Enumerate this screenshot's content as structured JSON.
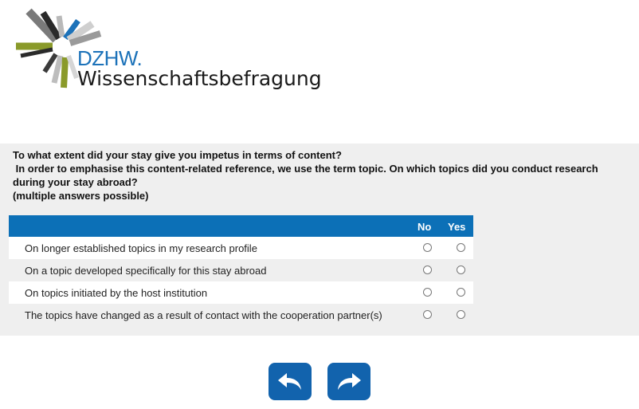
{
  "brand": {
    "org": "DZHW.",
    "product": "Wissenschaftsbefragung"
  },
  "question": {
    "lines": [
      "To what extent did your stay give you impetus in terms of content?",
      " In order to emphasise this content-related reference, we use the term topic. On which topics did you conduct research",
      "during your stay abroad?",
      "(multiple answers possible)"
    ]
  },
  "matrix": {
    "columns": [
      "No",
      "Yes"
    ],
    "rows": [
      {
        "label": "On longer established topics in my research profile",
        "value": null
      },
      {
        "label": "On a topic developed specifically for this stay abroad",
        "value": null
      },
      {
        "label": "On topics initiated by the host institution",
        "value": null
      },
      {
        "label": "The topics have changed as a result of contact with the cooperation partner(s)",
        "value": null
      }
    ]
  },
  "navigation": {
    "back_icon": "back-arrow-icon",
    "next_icon": "forward-arrow-icon"
  },
  "colors": {
    "header_blue": "#0c70b7",
    "button_blue": "#1263ad",
    "brand_blue": "#1c72b9"
  }
}
